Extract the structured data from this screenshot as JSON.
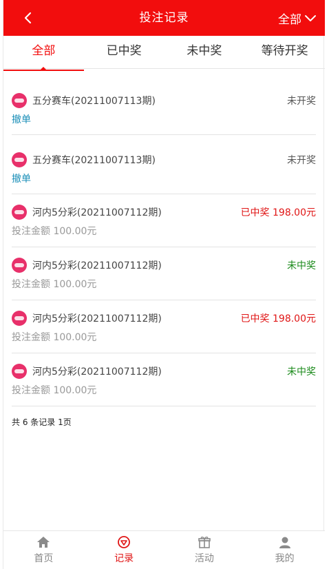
{
  "header": {
    "title": "投注记录",
    "filter_label": "全部"
  },
  "tabs": [
    {
      "label": "全部",
      "active": true
    },
    {
      "label": "已中奖",
      "active": false
    },
    {
      "label": "未中奖",
      "active": false
    },
    {
      "label": "等待开奖",
      "active": false
    }
  ],
  "records": [
    {
      "lottery": "五分赛车(20211007113期)",
      "status": "未开奖",
      "detail": "撤单"
    },
    {
      "lottery": "五分赛车(20211007113期)",
      "status": "未开奖",
      "detail": "撤单"
    },
    {
      "lottery": "河内5分彩(20211007112期)",
      "status": "已中奖 198.00元",
      "detail": "投注金额 100.00元"
    },
    {
      "lottery": "河内5分彩(20211007112期)",
      "status": "未中奖",
      "detail": "投注金额 100.00元"
    },
    {
      "lottery": "河内5分彩(20211007112期)",
      "status": "已中奖 198.00元",
      "detail": "投注金额 100.00元"
    },
    {
      "lottery": "河内5分彩(20211007112期)",
      "status": "未中奖",
      "detail": "投注金额 100.00元"
    }
  ],
  "summary": "共 6 条记录 1页",
  "bottom_nav": [
    {
      "label": "首页",
      "icon": "home-icon"
    },
    {
      "label": "记录",
      "icon": "record-icon"
    },
    {
      "label": "活动",
      "icon": "gift-icon"
    },
    {
      "label": "我的",
      "icon": "user-icon"
    }
  ],
  "colors": {
    "brand": "#f20d0d",
    "win": "#e01515",
    "lose": "#1a8a1a",
    "cancel": "#1b8fb8"
  }
}
